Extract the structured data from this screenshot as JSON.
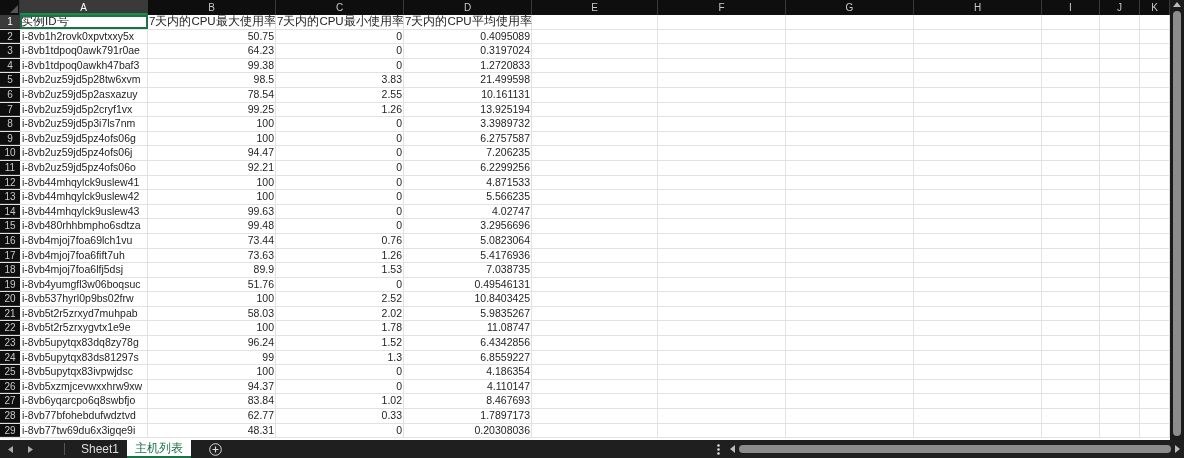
{
  "columns": [
    {
      "label": "A",
      "selected": true
    },
    {
      "label": "B",
      "selected": false
    },
    {
      "label": "C",
      "selected": false
    },
    {
      "label": "D",
      "selected": false
    },
    {
      "label": "E",
      "selected": false
    },
    {
      "label": "F",
      "selected": false
    },
    {
      "label": "G",
      "selected": false
    },
    {
      "label": "H",
      "selected": false
    },
    {
      "label": "I",
      "selected": false
    },
    {
      "label": "J",
      "selected": false
    },
    {
      "label": "K",
      "selected": false
    }
  ],
  "rows": [
    {
      "number": "1",
      "kind": "header",
      "selected": true,
      "cells": [
        "实例ID号",
        "7天内的CPU最大使用率",
        "7天内的CPU最小使用率",
        "7天内的CPU平均使用率"
      ]
    },
    {
      "number": "2",
      "kind": "data",
      "selected": false,
      "cells": [
        "i-8vb1h2rovk0xpvtxxy5x",
        "50.75",
        "0",
        "0.4095089"
      ]
    },
    {
      "number": "3",
      "kind": "data",
      "selected": false,
      "cells": [
        "i-8vb1tdpoq0awk791r0ae",
        "64.23",
        "0",
        "0.3197024"
      ]
    },
    {
      "number": "4",
      "kind": "data",
      "selected": false,
      "cells": [
        "i-8vb1tdpoq0awkh47baf3",
        "99.38",
        "0",
        "1.2720833"
      ]
    },
    {
      "number": "5",
      "kind": "data",
      "selected": false,
      "cells": [
        "i-8vb2uz59jd5p28tw6xvm",
        "98.5",
        "3.83",
        "21.499598"
      ]
    },
    {
      "number": "6",
      "kind": "data",
      "selected": false,
      "cells": [
        "i-8vb2uz59jd5p2asxazuy",
        "78.54",
        "2.55",
        "10.161131"
      ]
    },
    {
      "number": "7",
      "kind": "data",
      "selected": false,
      "cells": [
        "i-8vb2uz59jd5p2cryf1vx",
        "99.25",
        "1.26",
        "13.925194"
      ]
    },
    {
      "number": "8",
      "kind": "data",
      "selected": false,
      "cells": [
        "i-8vb2uz59jd5p3i7ls7nm",
        "100",
        "0",
        "3.3989732"
      ]
    },
    {
      "number": "9",
      "kind": "data",
      "selected": false,
      "cells": [
        "i-8vb2uz59jd5pz4ofs06g",
        "100",
        "0",
        "6.2757587"
      ]
    },
    {
      "number": "10",
      "kind": "data",
      "selected": false,
      "cells": [
        "i-8vb2uz59jd5pz4ofs06j",
        "94.47",
        "0",
        "7.206235"
      ]
    },
    {
      "number": "11",
      "kind": "data",
      "selected": false,
      "cells": [
        "i-8vb2uz59jd5pz4ofs06o",
        "92.21",
        "0",
        "6.2299256"
      ]
    },
    {
      "number": "12",
      "kind": "data",
      "selected": false,
      "cells": [
        "i-8vb44mhqylck9uslew41",
        "100",
        "0",
        "4.871533"
      ]
    },
    {
      "number": "13",
      "kind": "data",
      "selected": false,
      "cells": [
        "i-8vb44mhqylck9uslew42",
        "100",
        "0",
        "5.566235"
      ]
    },
    {
      "number": "14",
      "kind": "data",
      "selected": false,
      "cells": [
        "i-8vb44mhqylck9uslew43",
        "99.63",
        "0",
        "4.02747"
      ]
    },
    {
      "number": "15",
      "kind": "data",
      "selected": false,
      "cells": [
        "i-8vb480rhhbmpho6sdtza",
        "99.48",
        "0",
        "3.2956696"
      ]
    },
    {
      "number": "16",
      "kind": "data",
      "selected": false,
      "cells": [
        "i-8vb4mjoj7foa69lch1vu",
        "73.44",
        "0.76",
        "5.0823064"
      ]
    },
    {
      "number": "17",
      "kind": "data",
      "selected": false,
      "cells": [
        "i-8vb4mjoj7foa6fift7uh",
        "73.63",
        "1.26",
        "5.4176936"
      ]
    },
    {
      "number": "18",
      "kind": "data",
      "selected": false,
      "cells": [
        "i-8vb4mjoj7foa6lfj5dsj",
        "89.9",
        "1.53",
        "7.038735"
      ]
    },
    {
      "number": "19",
      "kind": "data",
      "selected": false,
      "cells": [
        "i-8vb4yumgfl3w06boqsuc",
        "51.76",
        "0",
        "0.49546131"
      ]
    },
    {
      "number": "20",
      "kind": "data",
      "selected": false,
      "cells": [
        "i-8vb537hyrl0p9bs02frw",
        "100",
        "2.52",
        "10.8403425"
      ]
    },
    {
      "number": "21",
      "kind": "data",
      "selected": false,
      "cells": [
        "i-8vb5t2r5zrxyd7muhpab",
        "58.03",
        "2.02",
        "5.9835267"
      ]
    },
    {
      "number": "22",
      "kind": "data",
      "selected": false,
      "cells": [
        "i-8vb5t2r5zrxygvtx1e9e",
        "100",
        "1.78",
        "11.08747"
      ]
    },
    {
      "number": "23",
      "kind": "data",
      "selected": false,
      "cells": [
        "i-8vb5upytqx83dq8zy78g",
        "96.24",
        "1.52",
        "6.4342856"
      ]
    },
    {
      "number": "24",
      "kind": "data",
      "selected": false,
      "cells": [
        "i-8vb5upytqx83ds81297s",
        "99",
        "1.3",
        "6.8559227"
      ]
    },
    {
      "number": "25",
      "kind": "data",
      "selected": false,
      "cells": [
        "i-8vb5upytqx83ivpwjdsc",
        "100",
        "0",
        "4.186354"
      ]
    },
    {
      "number": "26",
      "kind": "data",
      "selected": false,
      "cells": [
        "i-8vb5xzmjcevwxxhrw9xw",
        "94.37",
        "0",
        "4.110147"
      ]
    },
    {
      "number": "27",
      "kind": "data",
      "selected": false,
      "cells": [
        "i-8vb6yqarcpo6q8swbfjo",
        "83.84",
        "1.02",
        "8.467693"
      ]
    },
    {
      "number": "28",
      "kind": "data",
      "selected": false,
      "cells": [
        "i-8vb77bfohebdufwdztvd",
        "62.77",
        "0.33",
        "1.7897173"
      ]
    },
    {
      "number": "29",
      "kind": "data",
      "selected": false,
      "cells": [
        "i-8vb77tw69du6x3igqe9i",
        "48.31",
        "0",
        "0.20308036"
      ]
    }
  ],
  "sheet_tabs": [
    {
      "label": "Sheet1",
      "selected": false
    },
    {
      "label": "主机列表",
      "selected": true
    }
  ]
}
